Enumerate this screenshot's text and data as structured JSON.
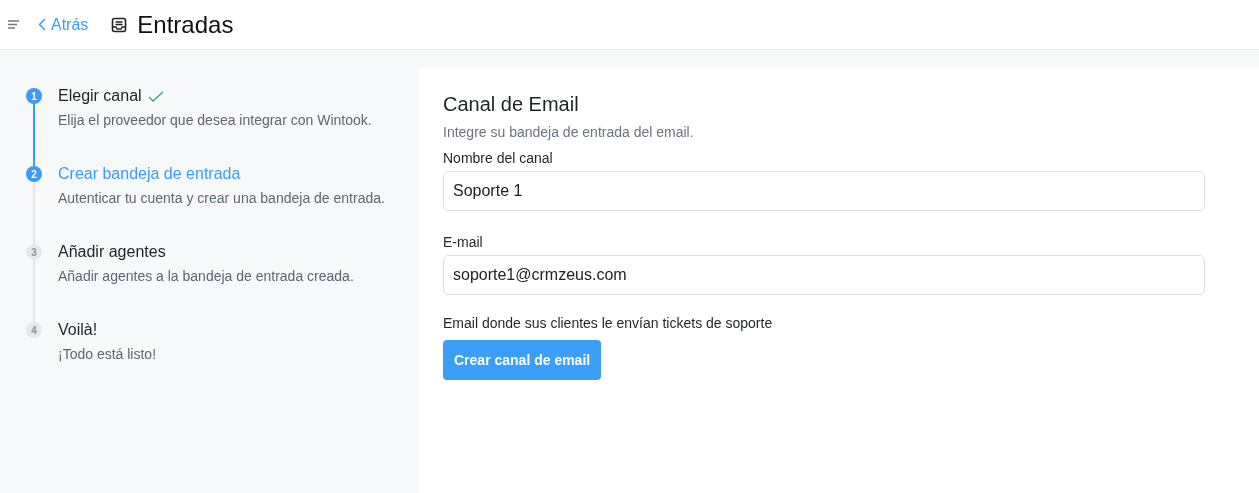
{
  "header": {
    "back_link": "Atrás",
    "title": "Entradas"
  },
  "steps": [
    {
      "number": "1",
      "title": "Elegir canal",
      "description": "Elija el proveedor que desea integrar con Wintook.",
      "completed": true,
      "selected": false
    },
    {
      "number": "2",
      "title": "Crear bandeja de entrada",
      "description": "Autenticar tu cuenta y crear una bandeja de entrada.",
      "completed": false,
      "selected": true
    },
    {
      "number": "3",
      "title": "Añadir agentes",
      "description": "Añadir agentes a la bandeja de entrada creada.",
      "completed": false,
      "selected": false
    },
    {
      "number": "4",
      "title": "Voilà!",
      "description": "¡Todo está listo!",
      "completed": false,
      "selected": false
    }
  ],
  "form": {
    "title": "Canal de Email",
    "subtitle": "Integre su bandeja de entrada del email.",
    "fields": [
      {
        "label": "Nombre del canal",
        "value": "Soporte 1"
      },
      {
        "label": "E-mail",
        "value": "soporte1@crmzeus.com"
      }
    ],
    "help_text": "Email donde sus clientes le envían tickets de soporte",
    "submit_button": "Crear canal de email"
  }
}
